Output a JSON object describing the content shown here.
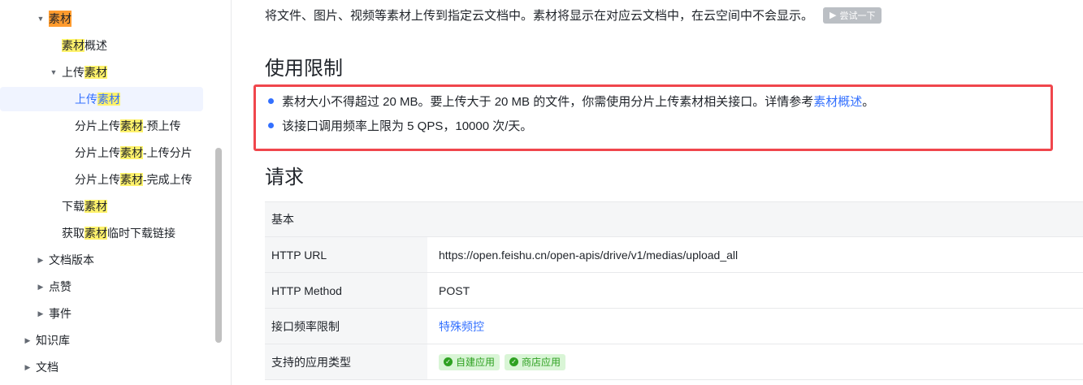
{
  "sidebar": {
    "items": [
      {
        "label": "素材",
        "level": 1
      },
      {
        "label_hl": "素材",
        "label_rest": "概述"
      },
      {
        "label_pre": "上传",
        "label_hl": "素材"
      },
      {
        "label_pre": "上传",
        "label_hl": "素材"
      },
      {
        "label_pre": "分片上传",
        "label_hl": "素材",
        "label_rest": "-预上传"
      },
      {
        "label_pre": "分片上传",
        "label_hl": "素材",
        "label_rest": "-上传分片"
      },
      {
        "label_pre": "分片上传",
        "label_hl": "素材",
        "label_rest": "-完成上传"
      },
      {
        "label_pre": "下载",
        "label_hl": "素材"
      },
      {
        "label_pre": "获取",
        "label_hl": "素材",
        "label_rest": "临时下载链接"
      },
      {
        "label": "文档版本"
      },
      {
        "label": "点赞"
      },
      {
        "label": "事件"
      },
      {
        "label": "知识库"
      },
      {
        "label": "文档"
      }
    ]
  },
  "main": {
    "intro_text": "将文件、图片、视频等素材上传到指定云文档中。素材将显示在对应云文档中，在云空间中不会显示。",
    "try_button": "尝试一下",
    "section_limits_title": "使用限制",
    "bullet1_text": "素材大小不得超过 20 MB。要上传大于 20 MB 的文件，你需使用分片上传素材相关接口。详情参考 ",
    "bullet1_link": "素材概述",
    "bullet1_end": "。",
    "bullet2_text": "该接口调用频率上限为 5 QPS，10000 次/天。",
    "section_request_title": "请求",
    "table": {
      "header": "基本",
      "rows": [
        {
          "key": "HTTP URL",
          "value": "https://open.feishu.cn/open-apis/drive/v1/medias/upload_all"
        },
        {
          "key": "HTTP Method",
          "value": "POST"
        },
        {
          "key": "接口频率限制",
          "value": "特殊频控"
        },
        {
          "key": "支持的应用类型",
          "tag1": "自建应用",
          "tag2": "商店应用"
        }
      ]
    }
  },
  "colors": {
    "accent": "#3370ff",
    "highlight_red": "#f0464c",
    "tag_green": "#2ea121"
  }
}
